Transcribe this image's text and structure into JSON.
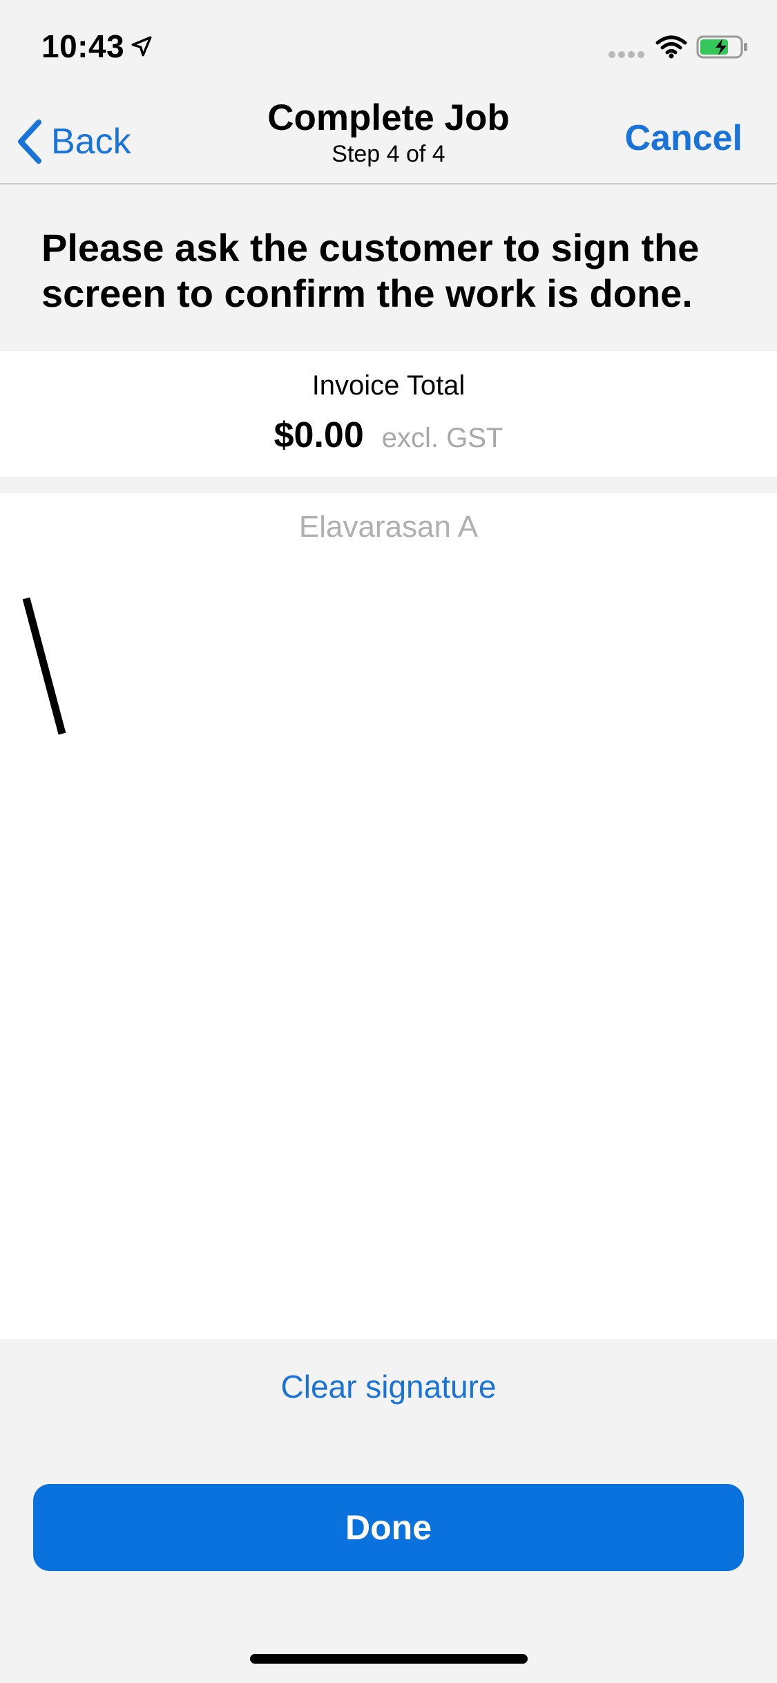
{
  "status_bar": {
    "time": "10:43",
    "icons": [
      "location-arrow-icon",
      "signal-icon",
      "wifi-icon",
      "battery-charging-icon"
    ]
  },
  "nav": {
    "back_label": "Back",
    "title": "Complete Job",
    "subtitle": "Step 4 of 4",
    "cancel_label": "Cancel"
  },
  "instruction": "Please ask the customer to sign the screen to confirm the work is done.",
  "invoice": {
    "label": "Invoice Total",
    "amount": "$0.00",
    "tax_note": "excl. GST"
  },
  "signature": {
    "signer_name": "Elavarasan A"
  },
  "actions": {
    "clear_label": "Clear signature",
    "done_label": "Done"
  },
  "colors": {
    "accent": "#1a73d9",
    "primary_button": "#0a72dc",
    "background": "#f3f3f3",
    "panel": "#ffffff",
    "muted_text": "#b0b0b0"
  }
}
